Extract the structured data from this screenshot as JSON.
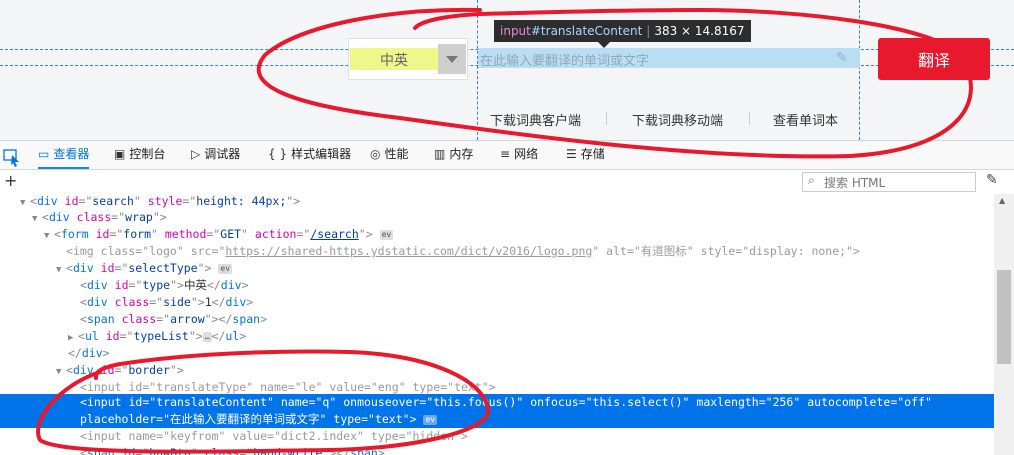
{
  "page": {
    "select_value": "中英",
    "input_placeholder": "在此输入要翻译的单词或文字",
    "translate_button": "翻译",
    "links": [
      "下载词典客户端",
      "下载词典移动端",
      "查看单词本"
    ],
    "tooltip": {
      "tag": "input",
      "id": "#translateContent",
      "size": "383 × 14.8167"
    }
  },
  "devtools": {
    "tabs": [
      {
        "label": "查看器",
        "icon": "inspector-icon"
      },
      {
        "label": "控制台",
        "icon": "console-icon"
      },
      {
        "label": "调试器",
        "icon": "debugger-icon"
      },
      {
        "label": "样式编辑器",
        "icon": "style-editor-icon"
      },
      {
        "label": "性能",
        "icon": "performance-icon"
      },
      {
        "label": "内存",
        "icon": "memory-icon"
      },
      {
        "label": "网络",
        "icon": "network-icon"
      },
      {
        "label": "存储",
        "icon": "storage-icon"
      }
    ],
    "search_placeholder": "搜索 HTML",
    "nodes": {
      "n0_tag": "div",
      "n0_a1": "id",
      "n0_v1": "search",
      "n0_a2": "style",
      "n0_v2": "height: 44px;",
      "n1_tag": "div",
      "n1_a1": "class",
      "n1_v1": "wrap",
      "n2_tag": "form",
      "n2_a1": "id",
      "n2_v1": "form",
      "n2_a2": "method",
      "n2_v2": "GET",
      "n2_a3": "action",
      "n2_v3": "/search",
      "n2_ev": "ev",
      "n3_tag": "img",
      "n3_a1": "class",
      "n3_v1": "logo",
      "n3_a2": "src",
      "n3_v2": "https://shared-https.ydstatic.com/dict/v2016/logo.png",
      "n3_a3": "alt",
      "n3_v3": "有道图标",
      "n3_a4": "style",
      "n3_v4": "display: none;",
      "n4_tag": "div",
      "n4_a1": "id",
      "n4_v1": "selectType",
      "n4_ev": "ev",
      "n5_tag": "div",
      "n5_a1": "id",
      "n5_v1": "type",
      "n5_text": "中英",
      "n5_close": "div",
      "n6_tag": "div",
      "n6_a1": "class",
      "n6_v1": "side",
      "n6_text": "1",
      "n6_close": "div",
      "n7_tag": "span",
      "n7_a1": "class",
      "n7_v1": "arrow",
      "n7_close": "span",
      "n8_tag": "ul",
      "n8_a1": "id",
      "n8_v1": "typeList",
      "n8_ellipsis": "…",
      "n8_close": "ul",
      "n9_close": "div",
      "n10_tag": "div",
      "n10_a1": "id",
      "n10_v1": "border",
      "n11_tag": "input",
      "n11_a1": "id",
      "n11_v1": "translateType",
      "n11_a2": "name",
      "n11_v2": "le",
      "n11_a3": "value",
      "n11_v3": "eng",
      "n11_a4": "type",
      "n11_v4": "text",
      "n12_tag": "input",
      "n12_a1": "id",
      "n12_v1": "translateContent",
      "n12_a2": "name",
      "n12_v2": "q",
      "n12_a3": "onmouseover",
      "n12_v3": "this.focus()",
      "n12_a4": "onfocus",
      "n12_v4": "this.select()",
      "n12_a5": "maxlength",
      "n12_v5": "256",
      "n12_a6": "autocomplete",
      "n12_v6": "off",
      "n12b_a7": "placeholder",
      "n12b_v7": "在此输入要翻译的单词或文字",
      "n12b_a8": "type",
      "n12b_v8": "text",
      "n12b_ev": "ev",
      "n13_tag": "input",
      "n13_a1": "name",
      "n13_v1": "keyfrom",
      "n13_a2": "value",
      "n13_v2": "dict2.index",
      "n13_a3": "type",
      "n13_v3": "hidden",
      "n14_tag": "span",
      "n14_a1": "id",
      "n14_v1": "hnwBtn",
      "n14_a2": "class",
      "n14_v2": "hand-write",
      "n14_close": "span"
    }
  },
  "colors": {
    "accent": "#0074e8",
    "button": "#e8192c",
    "annotation": "#e8192c"
  }
}
